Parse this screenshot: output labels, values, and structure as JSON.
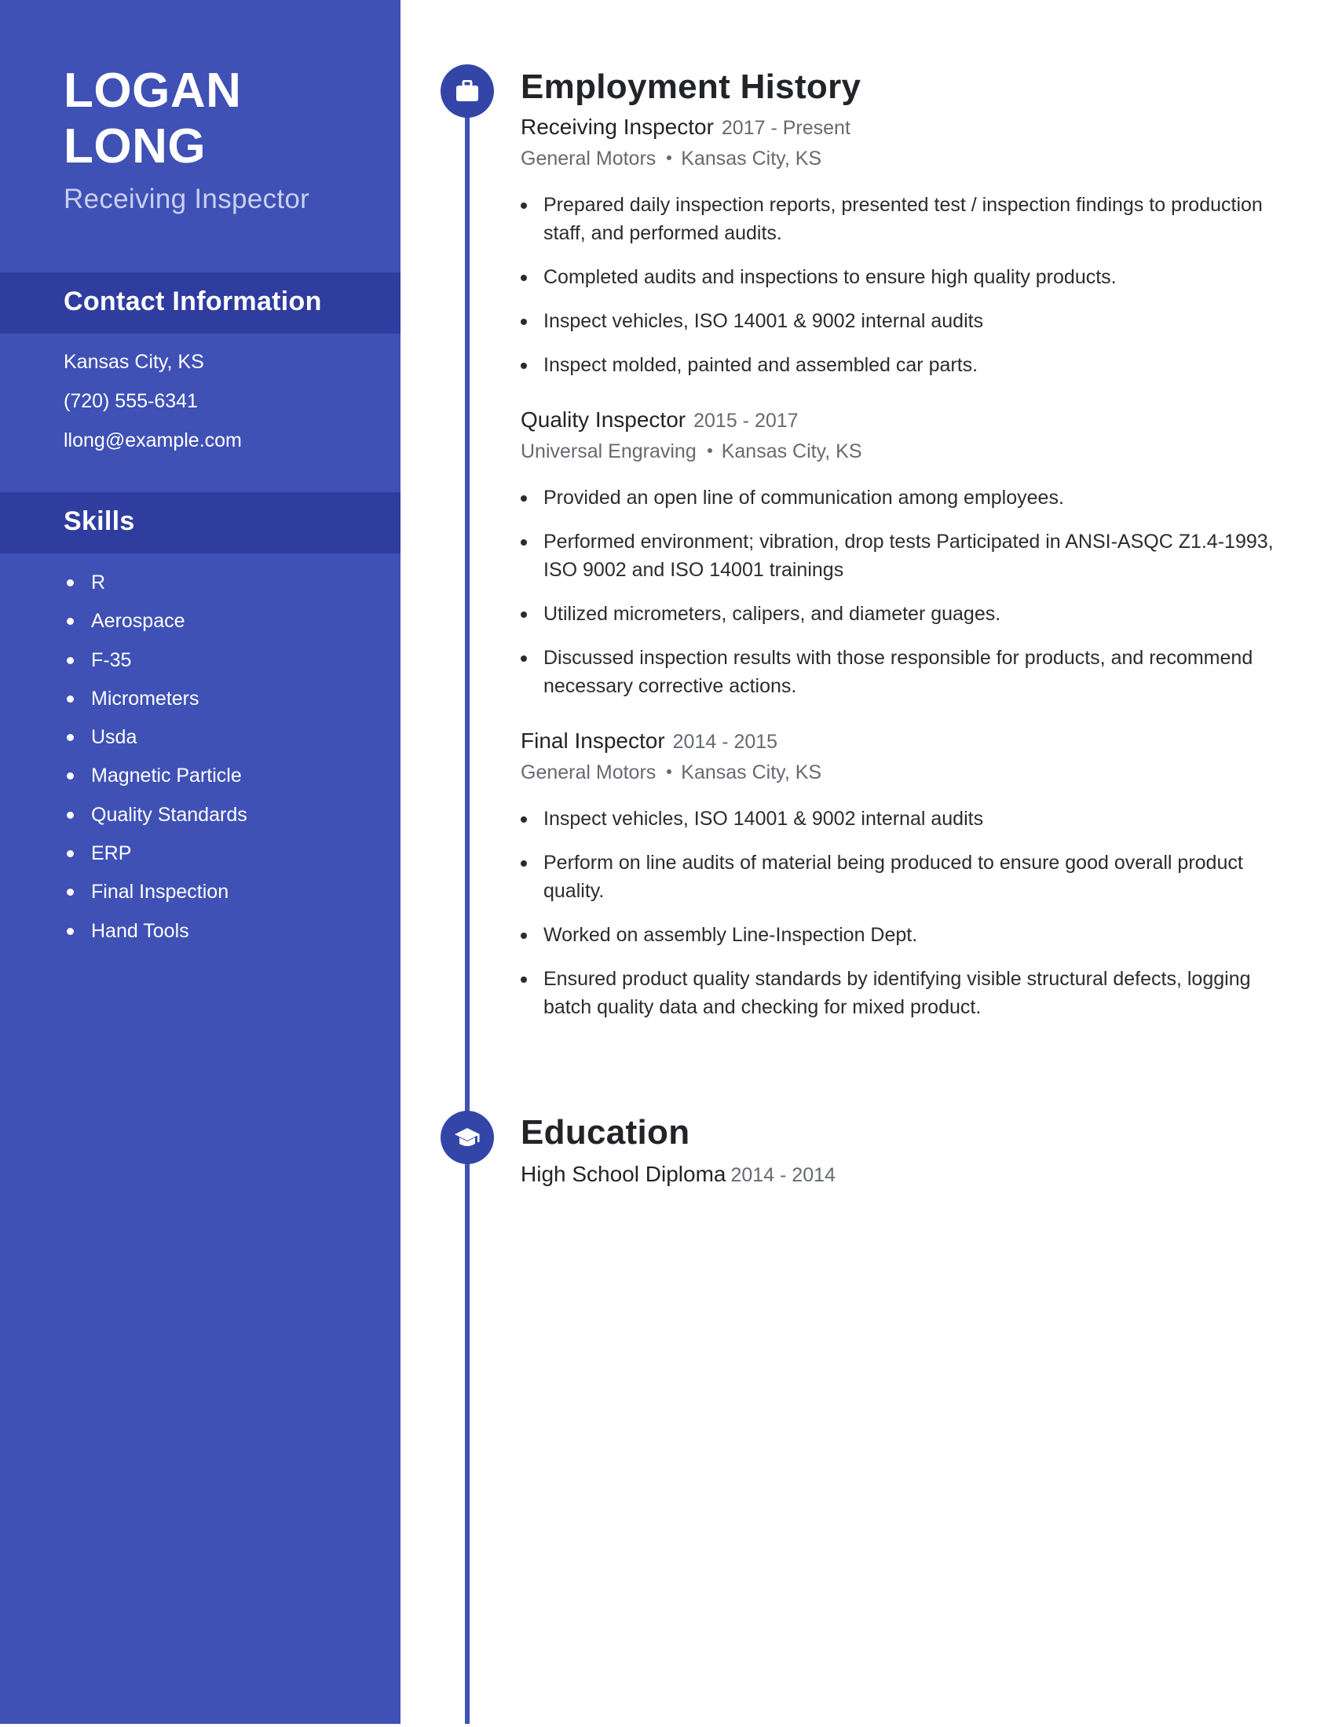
{
  "profile": {
    "first_name": "LOGAN",
    "last_name": "LONG",
    "title": "Receiving Inspector"
  },
  "contact": {
    "heading": "Contact Information",
    "location": "Kansas City, KS",
    "phone": "(720) 555-6341",
    "email": "llong@example.com"
  },
  "skills": {
    "heading": "Skills",
    "items": [
      "R",
      "Aerospace",
      "F-35",
      "Micrometers",
      "Usda",
      "Magnetic Particle",
      "Quality Standards",
      "ERP",
      "Final Inspection",
      "Hand Tools"
    ]
  },
  "employment": {
    "heading": "Employment History",
    "icon": "briefcase-icon",
    "jobs": [
      {
        "title": "Receiving Inspector",
        "dates": "2017 - Present",
        "company": "General Motors",
        "location": "Kansas City, KS",
        "bullets": [
          "Prepared daily inspection reports, presented test / inspection findings to production staff, and performed audits.",
          "Completed audits and inspections to ensure high quality products.",
          "Inspect vehicles, ISO 14001 & 9002 internal audits",
          "Inspect molded, painted and assembled car parts."
        ]
      },
      {
        "title": "Quality Inspector",
        "dates": "2015 - 2017",
        "company": "Universal Engraving",
        "location": "Kansas City, KS",
        "bullets": [
          "Provided an open line of communication among employees.",
          "Performed environment; vibration, drop tests Participated in ANSI-ASQC Z1.4-1993, ISO 9002 and ISO 14001 trainings",
          "Utilized micrometers, calipers, and diameter guages.",
          "Discussed inspection results with those responsible for products, and recommend necessary corrective actions."
        ]
      },
      {
        "title": "Final Inspector",
        "dates": "2014 - 2015",
        "company": "General Motors",
        "location": "Kansas City, KS",
        "bullets": [
          "Inspect vehicles, ISO 14001 & 9002 internal audits",
          "Perform on line audits of material being produced to ensure good overall product quality.",
          "Worked on assembly Line-Inspection Dept.",
          "Ensured product quality standards by identifying visible structural defects, logging batch quality data and checking for mixed product."
        ]
      }
    ]
  },
  "education": {
    "heading": "Education",
    "icon": "graduation-cap-icon",
    "entries": [
      {
        "degree": "High School Diploma",
        "dates": "2014 - 2014"
      }
    ]
  },
  "colors": {
    "sidebar": "#3f51b5",
    "sidebar_band": "#2f3d9f",
    "accent": "#3346a8",
    "text": "#222428",
    "muted": "#666a70"
  }
}
